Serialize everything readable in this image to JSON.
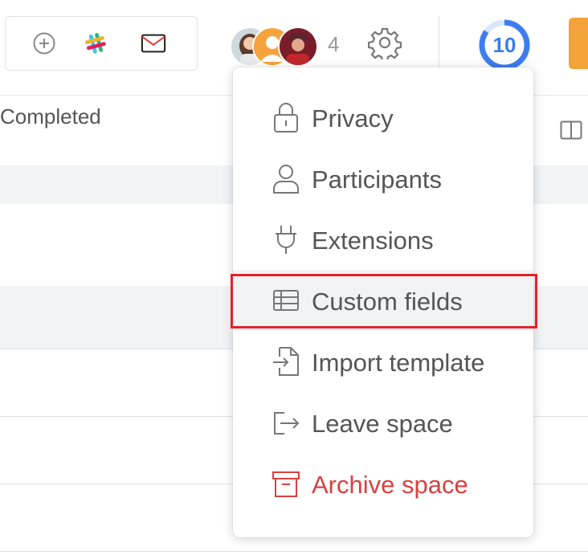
{
  "toolbar": {
    "add_icon": "plus-circle-icon",
    "slack_icon": "slack-icon",
    "mail_icon": "mail-icon"
  },
  "participants": {
    "count": "4"
  },
  "settings_icon": "gear-icon",
  "progress_badge": {
    "value": "10",
    "progress": 0.85,
    "color": "#3d7df0"
  },
  "table": {
    "column_header": "Completed"
  },
  "menu": {
    "items": [
      {
        "label": "Privacy",
        "icon": "lock-icon"
      },
      {
        "label": "Participants",
        "icon": "user-icon"
      },
      {
        "label": "Extensions",
        "icon": "plug-icon"
      },
      {
        "label": "Custom fields",
        "icon": "table-icon",
        "highlighted": true
      },
      {
        "label": "Import template",
        "icon": "import-file-icon"
      },
      {
        "label": "Leave space",
        "icon": "exit-icon"
      },
      {
        "label": "Archive space",
        "icon": "archive-icon",
        "color": "#d94040"
      }
    ]
  },
  "colors": {
    "danger": "#d94040",
    "highlight_border": "#e0232b",
    "accent_orange": "#f2a33a",
    "accent_blue": "#3d7df0"
  }
}
